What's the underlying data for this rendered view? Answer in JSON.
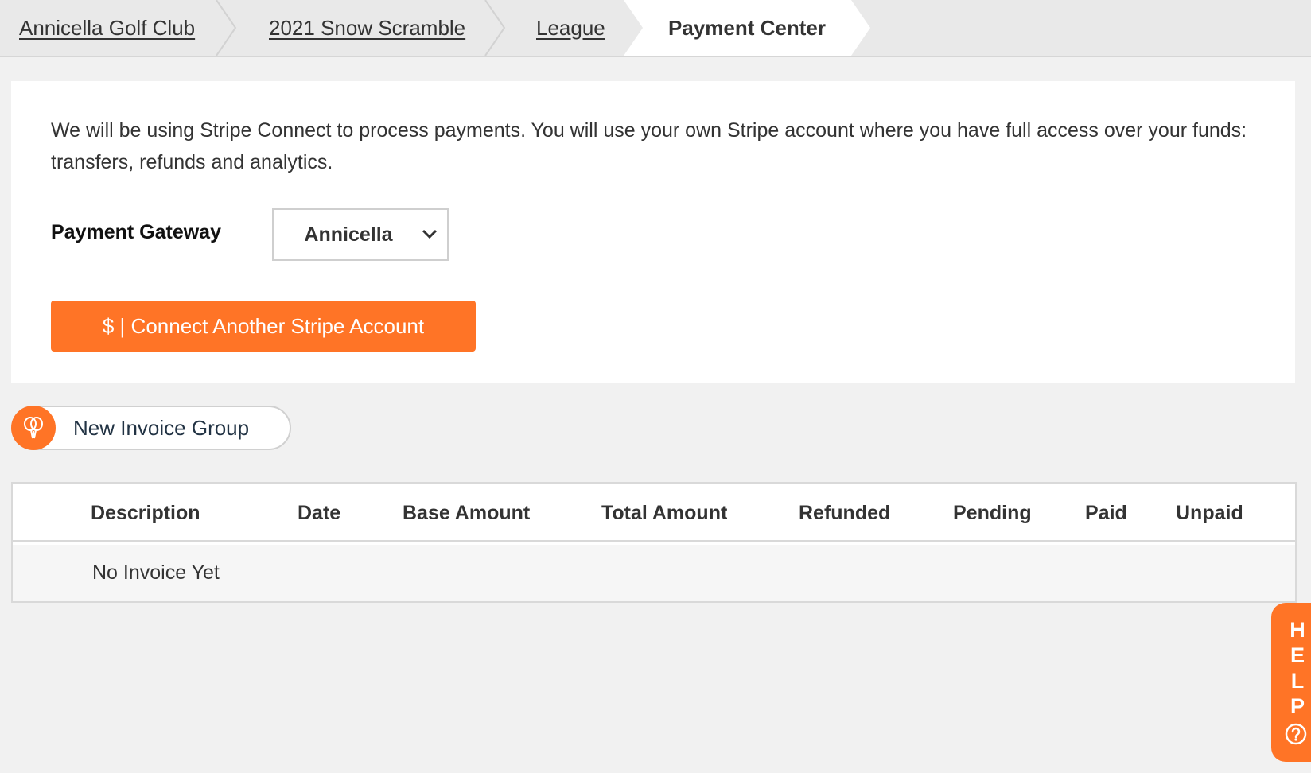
{
  "breadcrumb": {
    "items": [
      {
        "label": "Annicella Golf Club"
      },
      {
        "label": "2021 Snow Scramble"
      },
      {
        "label": "League"
      }
    ],
    "active": "Payment Center"
  },
  "payment": {
    "intro": "We will be using Stripe Connect to process payments. You will use your own Stripe account where you have full access over your funds: transfers, refunds and analytics.",
    "gateway_label": "Payment Gateway",
    "gateway_value": "Annicella",
    "connect_button": "$ | Connect Another Stripe Account"
  },
  "invoice_group": {
    "new_label": "New Invoice Group"
  },
  "invoice_table": {
    "columns": [
      "Description",
      "Date",
      "Base Amount",
      "Total Amount",
      "Refunded",
      "Pending",
      "Paid",
      "Unpaid"
    ],
    "empty_text": "No Invoice Yet"
  },
  "help": {
    "letters": [
      "H",
      "E",
      "L",
      "P"
    ]
  },
  "colors": {
    "accent": "#ff7426",
    "background": "#f1f1f1"
  }
}
